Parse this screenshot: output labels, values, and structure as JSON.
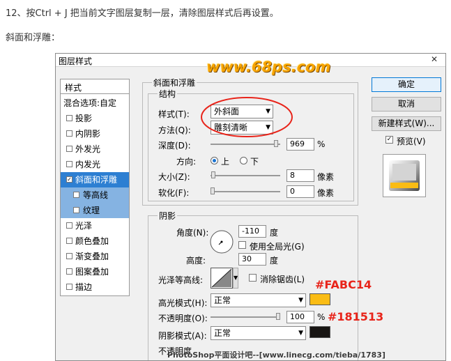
{
  "article": {
    "step": "12、按Ctrl + J 把当前文字图层复制一层，清除图层样式后再设置。",
    "section": "斜面和浮雕："
  },
  "dialog": {
    "title": "图层样式",
    "close": "✕",
    "watermark_top": "www.68ps.com",
    "watermark_bottom": "PhotoShop平面设计吧--[www.linecg.com/tieba/1783]"
  },
  "sidebar": {
    "header": "样式",
    "blend": "混合选项:自定",
    "items": [
      {
        "label": "投影",
        "checked": false
      },
      {
        "label": "内阴影",
        "checked": false
      },
      {
        "label": "外发光",
        "checked": false
      },
      {
        "label": "内发光",
        "checked": false
      },
      {
        "label": "斜面和浮雕",
        "checked": true
      },
      {
        "label": "等高线",
        "checked": false
      },
      {
        "label": "纹理",
        "checked": false
      },
      {
        "label": "光泽",
        "checked": false
      },
      {
        "label": "颜色叠加",
        "checked": false
      },
      {
        "label": "渐变叠加",
        "checked": false
      },
      {
        "label": "图案叠加",
        "checked": false
      },
      {
        "label": "描边",
        "checked": false
      }
    ],
    "check_mark": "✓"
  },
  "bevel": {
    "group": "斜面和浮雕",
    "structure": "结构",
    "style_label": "样式(T):",
    "style_value": "外斜面",
    "technique_label": "方法(Q):",
    "technique_value": "雕刻清晰",
    "depth_label": "深度(D):",
    "depth_value": "969",
    "depth_unit": "%",
    "depth_level": 0.97,
    "direction_label": "方向:",
    "direction_up": "上",
    "direction_down": "下",
    "size_label": "大小(Z):",
    "size_value": "8",
    "size_unit": "像素",
    "soften_label": "软化(F):",
    "soften_value": "0",
    "soften_unit": "像素"
  },
  "shading": {
    "group": "阴影",
    "angle_label": "角度(N):",
    "angle_value": "-110",
    "angle_unit": "度",
    "global_light": "使用全局光(G)",
    "altitude_label": "高度:",
    "altitude_value": "30",
    "altitude_unit": "度",
    "gloss_label": "光泽等高线:",
    "antialias": "消除锯齿(L)",
    "highlight_label": "高光模式(H):",
    "highlight_mode": "正常",
    "highlight_color": "#FABC14",
    "opacity_label": "不透明度(O):",
    "opacity_value": "100",
    "opacity_unit": "%",
    "opacity_level": 1.0,
    "shadow_label": "阴影模式(A):",
    "shadow_mode": "正常",
    "shadow_color": "#181513",
    "shadow_opacity_label": "不透明度"
  },
  "buttons": {
    "ok": "确定",
    "cancel": "取消",
    "new_style": "新建样式(W)...",
    "preview": "预览(V)"
  },
  "annotations": {
    "highlight_hex": "#FABC14",
    "shadow_hex": "#181513"
  }
}
